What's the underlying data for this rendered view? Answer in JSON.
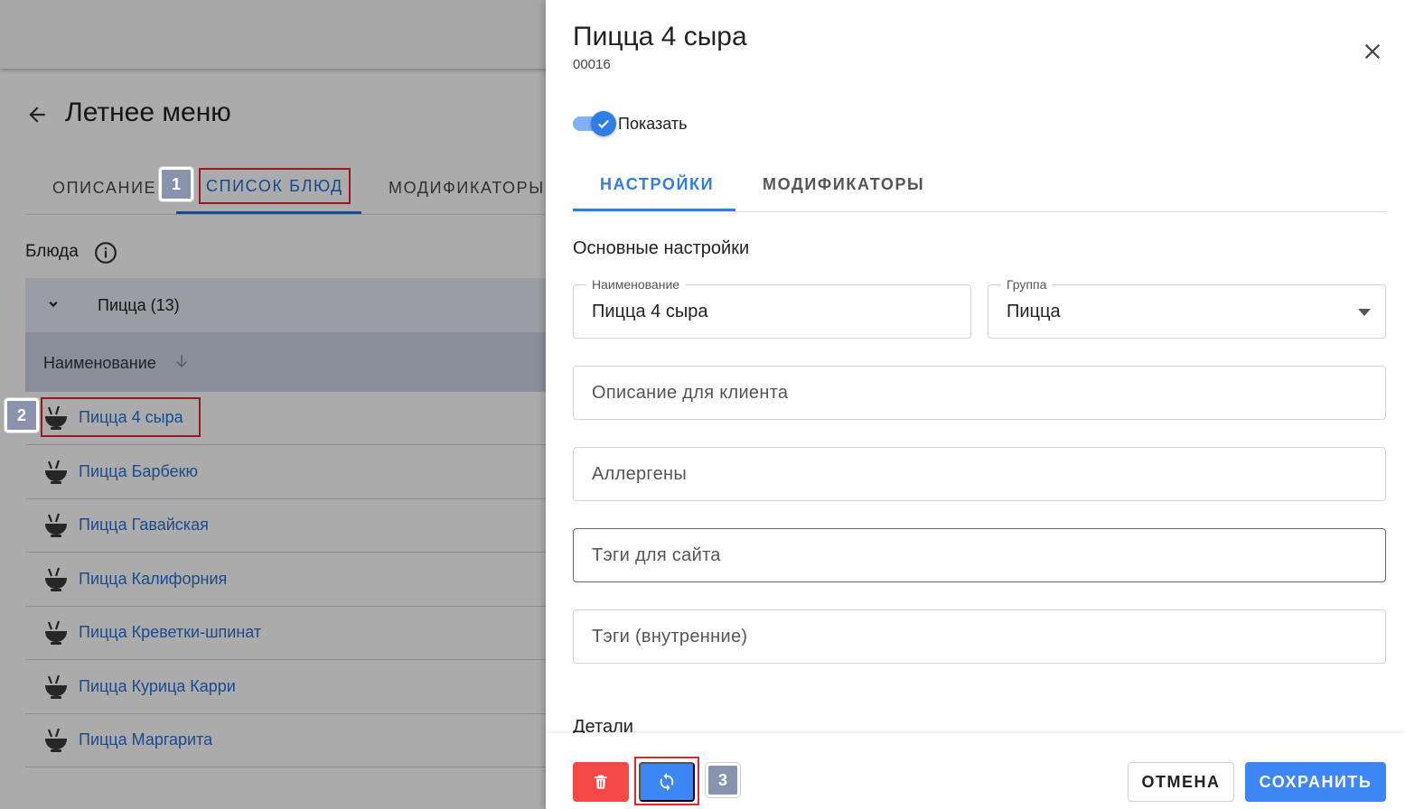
{
  "background": {
    "page_title": "Летнее меню",
    "tabs": [
      {
        "label": "Описание"
      },
      {
        "label": "Список блюд"
      },
      {
        "label": "Модификаторы"
      }
    ],
    "section_title": "Блюда",
    "group": {
      "label": "Пицца (13)"
    },
    "column_header": "Наименование",
    "dishes": [
      "Пицца 4 сыра",
      "Пицца Барбекю",
      "Пицца Гавайская",
      "Пицца Калифорния",
      "Пицца Креветки-шпинат",
      "Пицца Курица Карри",
      "Пицца Маргарита"
    ]
  },
  "badges": {
    "b1": "1",
    "b2": "2",
    "b3": "3"
  },
  "drawer": {
    "title": "Пицца 4 сыра",
    "code": "00016",
    "show_toggle": {
      "label": "Показать",
      "on": true
    },
    "tabs": [
      {
        "label": "НАСТРОЙКИ",
        "active": true
      },
      {
        "label": "МОДИФИКАТОРЫ",
        "active": false
      }
    ],
    "section_main": "Основные настройки",
    "fields": {
      "name": {
        "label": "Наименование",
        "value": "Пицца 4 сыра"
      },
      "group": {
        "label": "Группа",
        "value": "Пицца"
      },
      "description": {
        "placeholder": "Описание для клиента"
      },
      "allergens": {
        "placeholder": "Аллергены"
      },
      "site_tags": {
        "placeholder": "Тэги для сайта"
      },
      "internal_tags": {
        "placeholder": "Тэги (внутренние)"
      }
    },
    "section_details": "Детали",
    "footer": {
      "cancel_label": "ОТМЕНА",
      "save_label": "СОХРАНИТЬ"
    }
  },
  "colors": {
    "accent": "#2f7ee8",
    "link": "#2a6fd6",
    "danger": "#f44848",
    "highlight": "#e0262f"
  }
}
